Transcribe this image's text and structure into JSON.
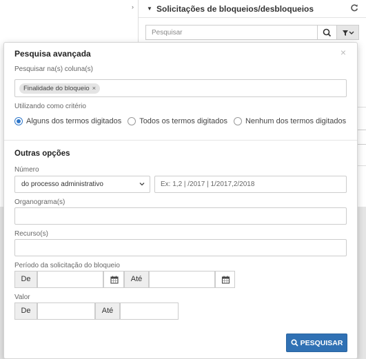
{
  "background": {
    "panel_title": "Solicitações de bloqueios/desbloqueios",
    "search_placeholder": "Pesquisar"
  },
  "advanced_search": {
    "title": "Pesquisa avançada",
    "columns_label": "Pesquisar na(s) coluna(s)",
    "selected_columns": [
      "Finalidade do bloqueio"
    ],
    "criteria_label": "Utilizando como critério",
    "criteria_options": [
      {
        "label": "Alguns dos termos digitados",
        "selected": true
      },
      {
        "label": "Todos os termos digitados",
        "selected": false
      },
      {
        "label": "Nenhum dos termos digitados",
        "selected": false
      }
    ],
    "other_options_title": "Outras opções",
    "numero_label": "Número",
    "numero_select_value": "do processo administrativo",
    "numero_placeholder": "Ex: 1,2 | /2017 | 1/2017,2/2018",
    "organograma_label": "Organograma(s)",
    "recurso_label": "Recurso(s)",
    "periodo_label": "Período da solicitação do bloqueio",
    "de_label": "De",
    "ate_label": "Até",
    "valor_label": "Valor",
    "search_button": "PESQUISAR"
  },
  "colors": {
    "primary": "#3071b4",
    "radio_selected": "#2f77c9",
    "backdrop": "#e5e5e5"
  }
}
